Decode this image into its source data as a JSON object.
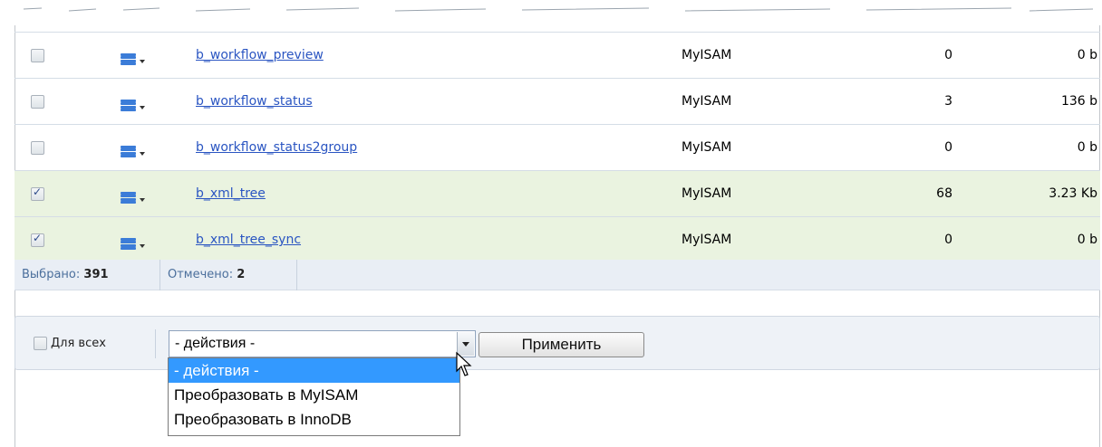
{
  "rows": [
    {
      "checked": false,
      "name": "b_workflow_preview",
      "engine": "MyISAM",
      "rows": "0",
      "size": "0 b"
    },
    {
      "checked": false,
      "name": "b_workflow_status",
      "engine": "MyISAM",
      "rows": "3",
      "size": "136 b"
    },
    {
      "checked": false,
      "name": "b_workflow_status2group",
      "engine": "MyISAM",
      "rows": "0",
      "size": "0 b"
    },
    {
      "checked": true,
      "name": "b_xml_tree",
      "engine": "MyISAM",
      "rows": "68",
      "size": "3.23 Kb"
    },
    {
      "checked": true,
      "name": "b_xml_tree_sync",
      "engine": "MyISAM",
      "rows": "0",
      "size": "0 b"
    }
  ],
  "footer": {
    "selected_label": "Выбрано:",
    "selected_value": "391",
    "marked_label": "Отмечено:",
    "marked_value": "2"
  },
  "actions": {
    "for_all_label": "Для всех",
    "for_all_checked": false,
    "select_value": "- действия -",
    "apply_label": "Применить",
    "options": [
      "- действия -",
      "Преобразовать в MyISAM",
      "Преобразовать в InnoDB"
    ],
    "selected_option": 0
  },
  "colors": {
    "link": "#2a55c2",
    "checked_row_bg": "#eaf3e0",
    "highlight_option": "#3399ff",
    "menu_icon": "#3b7cd8"
  }
}
